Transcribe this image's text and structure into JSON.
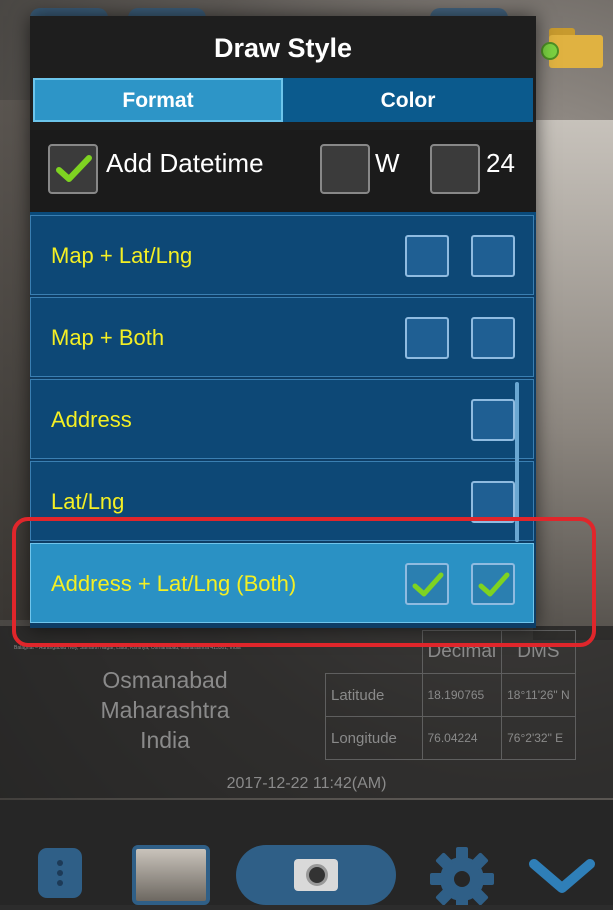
{
  "dialog": {
    "title": "Draw Style",
    "tabs": [
      {
        "label": "Format",
        "active": true
      },
      {
        "label": "Color",
        "active": false
      }
    ],
    "options": {
      "add_datetime": {
        "label": "Add Datetime",
        "checked": true
      },
      "w": {
        "label": "W",
        "checked": false
      },
      "h24": {
        "label": "24",
        "checked": false
      }
    },
    "rows": [
      {
        "label": "Map + Lat/Lng",
        "boxes": [
          false,
          false
        ],
        "selected": false
      },
      {
        "label": "Map + Both",
        "boxes": [
          false,
          false
        ],
        "selected": false
      },
      {
        "label": "Address",
        "boxes": [
          false
        ],
        "selected": false
      },
      {
        "label": "Lat/Lng",
        "boxes": [
          false
        ],
        "selected": false
      },
      {
        "label": "Address + Lat/Lng (Both)",
        "boxes": [
          true,
          true
        ],
        "selected": true
      }
    ]
  },
  "stamp": {
    "note": "Balaghat – Aurangabad Hwy, Samarth Nagar, Latur, Kshtriya, Osmanabad, Maharashtra 413501, India",
    "address": [
      "Osmanabad",
      "Maharashtra",
      "India"
    ],
    "headers": [
      "Decimal",
      "DMS"
    ],
    "latitude": {
      "label": "Latitude",
      "decimal": "18.190765",
      "dms": "18°11'26\" N"
    },
    "longitude": {
      "label": "Longitude",
      "decimal": "76.04224",
      "dms": "76°2'32\" E"
    },
    "datetime": "2017-12-22  11:42(AM)"
  },
  "colors": {
    "accent": "#2d95c7",
    "row_bg": "#0d4876",
    "row_text": "#f4ef24",
    "check": "#7ed321",
    "highlight": "#e0262b"
  },
  "icons": [
    "check-icon",
    "menu-icon",
    "camera-icon",
    "gear-icon",
    "chevron-down-icon",
    "folder-icon"
  ]
}
